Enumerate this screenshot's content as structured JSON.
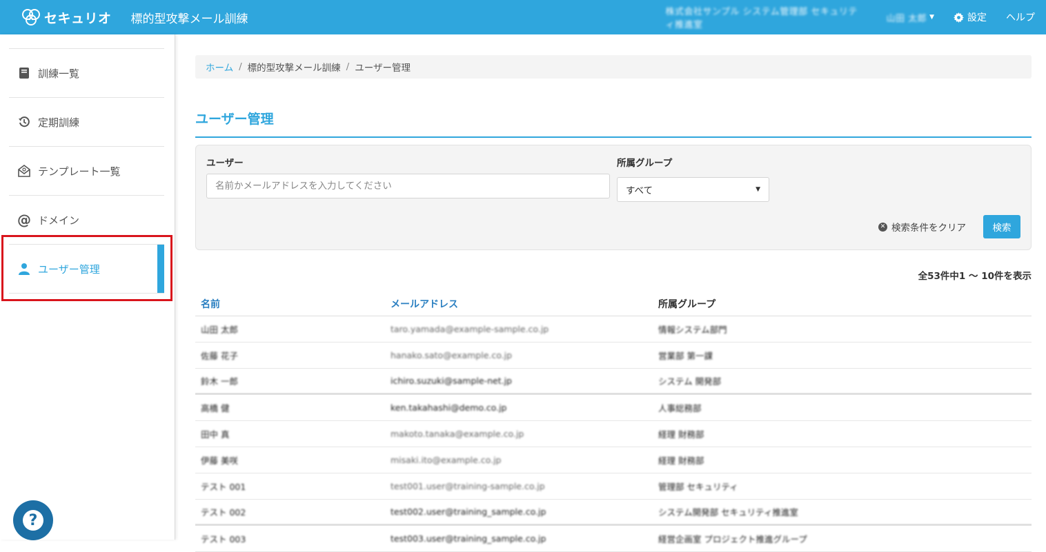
{
  "header": {
    "brand": "セキュリオ",
    "app_title": "標的型攻撃メール訓練",
    "tenant": "株式会社サンプル システム管理部 セキュリティ推進室",
    "user": "山田 太郎",
    "settings_label": "設定",
    "help_label": "ヘルプ"
  },
  "sidebar": {
    "items": [
      {
        "label": "訓練一覧",
        "icon": "book-icon"
      },
      {
        "label": "定期訓練",
        "icon": "history-icon"
      },
      {
        "label": "テンプレート一覧",
        "icon": "mail-template-icon"
      },
      {
        "label": "ドメイン",
        "icon": "at-icon"
      },
      {
        "label": "ユーザー管理",
        "icon": "user-icon",
        "active": true
      }
    ],
    "help_fab": "?"
  },
  "breadcrumb": [
    "ホーム",
    "標的型攻撃メール訓練",
    "ユーザー管理"
  ],
  "page_title": "ユーザー管理",
  "search": {
    "user_label": "ユーザー",
    "user_placeholder": "名前かメールアドレスを入力してください",
    "group_label": "所属グループ",
    "group_selected": "すべて",
    "clear_label": "検索条件をクリア",
    "search_button": "検索"
  },
  "result_count": "全53件中1 〜 10件を表示",
  "table": {
    "headers": [
      "名前",
      "メールアドレス",
      "所属グループ"
    ],
    "rows": [
      {
        "name": "山田 太郎",
        "email": "taro.yamada@example-sample.co.jp",
        "group": "情報システム部門"
      },
      {
        "name": "佐藤 花子",
        "email": "hanako.sato@example.co.jp",
        "group": "営業部 第一課"
      },
      {
        "name": "鈴木 一郎",
        "email": "ichiro.suzuki@sample-net.jp",
        "group": "システム 開発部"
      },
      {
        "name": "高橋 健",
        "email": "ken.takahashi@demo.co.jp",
        "group": "人事総務部"
      },
      {
        "name": "田中 真",
        "email": "makoto.tanaka@example.co.jp",
        "group": "経理 財務部"
      },
      {
        "name": "伊藤 美咲",
        "email": "misaki.ito@example.co.jp",
        "group": "経理 財務部"
      },
      {
        "name": "テスト 001",
        "email": "test001.user@training-sample.co.jp",
        "group": "管理部 セキュリティ"
      },
      {
        "name": "テスト 002",
        "email": "test002.user@training_sample.co.jp",
        "group": "システム開発部 セキュリティ推進室"
      },
      {
        "name": "テスト 003",
        "email": "test003.user@training_sample.co.jp",
        "group": "経営企画室 プロジェクト推進グループ"
      }
    ]
  }
}
